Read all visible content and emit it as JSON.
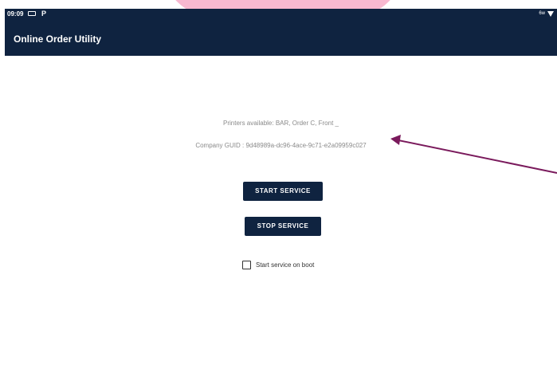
{
  "status_bar": {
    "time": "09:09",
    "notification_icon": "notification-icon",
    "p_icon": "P",
    "signal_text": "6w",
    "wifi_icon": "wifi-icon"
  },
  "header": {
    "title": "Online Order Utility"
  },
  "main": {
    "printers_available": "Printers available: BAR, Order C, Front _",
    "company_guid": "Company GUID : 9d48989a-dc96-4ace-9c71-e2a09959c027",
    "start_button_label": "START SERVICE",
    "stop_button_label": "STOP SERVICE",
    "boot_checkbox_label": "Start service on boot",
    "boot_checkbox_checked": false
  },
  "annotation": {
    "arrow_color": "#7a1a5c"
  },
  "colors": {
    "header_bg": "#0f2340",
    "button_bg": "#0f2340",
    "accent_pink": "#f7b8d0"
  }
}
